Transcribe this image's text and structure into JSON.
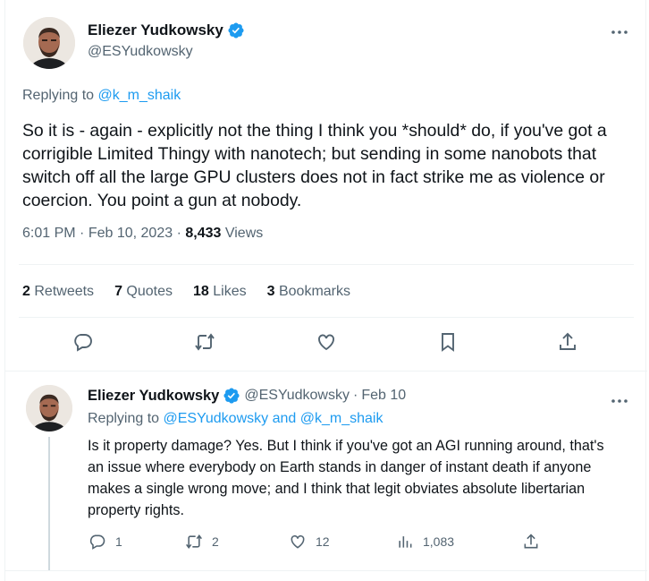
{
  "main_tweet": {
    "author_name": "Eliezer Yudkowsky",
    "author_handle": "@ESYudkowsky",
    "replying_prefix": "Replying to",
    "replying_to": "@k_m_shaik",
    "text": "So it is - again - explicitly not the thing I think you *should* do, if you've got a corrigible Limited Thingy with nanotech; but sending in some nanobots that switch off all the large GPU clusters does not in fact strike me as violence or coercion.  You point a gun at nobody.",
    "time": "6:01 PM",
    "date": "Feb 10, 2023",
    "views_count": "8,433",
    "views_label": "Views",
    "stats": {
      "retweets_count": "2",
      "retweets_label": "Retweets",
      "quotes_count": "7",
      "quotes_label": "Quotes",
      "likes_count": "18",
      "likes_label": "Likes",
      "bookmarks_count": "3",
      "bookmarks_label": "Bookmarks"
    }
  },
  "reply_tweet": {
    "author_name": "Eliezer Yudkowsky",
    "author_handle": "@ESYudkowsky",
    "separator": "·",
    "date": "Feb 10",
    "replying_prefix": "Replying to",
    "replying_to_1": "@ESYudkowsky",
    "replying_and": "and",
    "replying_to_2": "@k_m_shaik",
    "text": "Is it property damage?  Yes.  But I think if you've got an AGI running around, that's an issue where everybody on Earth stands in danger of instant death if anyone makes a single wrong move; and I think that legit obviates absolute libertarian property rights.",
    "counts": {
      "replies": "1",
      "retweets": "2",
      "likes": "12",
      "views": "1,083"
    }
  },
  "icons": {
    "verified": "verified-badge-icon",
    "more": "more-options-icon",
    "reply": "reply-icon",
    "retweet": "retweet-icon",
    "like": "heart-icon",
    "bookmark": "bookmark-icon",
    "share": "share-icon",
    "views": "views-chart-icon"
  },
  "colors": {
    "accent": "#1d9bf0",
    "text": "#0f1419",
    "muted": "#536471",
    "border": "#eff3f4"
  }
}
